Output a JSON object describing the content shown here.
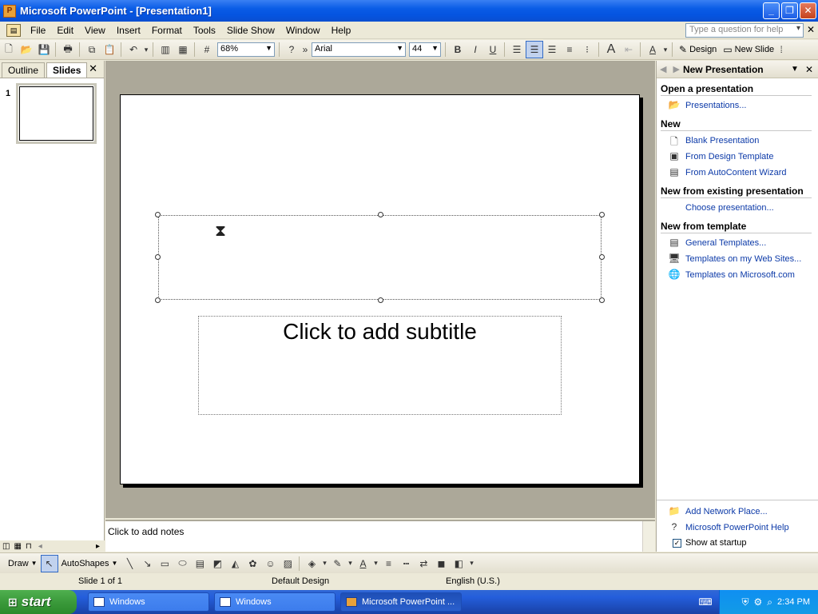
{
  "window": {
    "title": "Microsoft PowerPoint - [Presentation1]"
  },
  "menu": {
    "items": [
      "File",
      "Edit",
      "View",
      "Insert",
      "Format",
      "Tools",
      "Slide Show",
      "Window",
      "Help"
    ],
    "help_placeholder": "Type a question for help"
  },
  "toolbar": {
    "zoom": "68%",
    "font": "Arial",
    "size": "44",
    "design_label": "Design",
    "new_slide_label": "New Slide"
  },
  "leftpane": {
    "tabs": [
      "Outline",
      "Slides"
    ],
    "slide_number": "1"
  },
  "slide": {
    "subtitle_placeholder": "Click to add subtitle"
  },
  "notes": {
    "placeholder": "Click to add notes"
  },
  "taskpane": {
    "title": "New Presentation",
    "sections": [
      {
        "heading": "Open a presentation",
        "links": [
          "Presentations..."
        ]
      },
      {
        "heading": "New",
        "links": [
          "Blank Presentation",
          "From Design Template",
          "From AutoContent Wizard"
        ]
      },
      {
        "heading": "New from existing presentation",
        "links": [
          "Choose presentation..."
        ]
      },
      {
        "heading": "New from template",
        "links": [
          "General Templates...",
          "Templates on my Web Sites...",
          "Templates on Microsoft.com"
        ]
      }
    ],
    "bottom_links": [
      "Add Network Place...",
      "Microsoft PowerPoint Help"
    ],
    "show_at_startup": "Show at startup"
  },
  "drawbar": {
    "draw_label": "Draw",
    "autoshapes_label": "AutoShapes"
  },
  "status": {
    "slide": "Slide 1 of 1",
    "design": "Default Design",
    "language": "English (U.S.)"
  },
  "taskbar": {
    "start_label": "start",
    "items": [
      "Windows",
      "Windows",
      "Microsoft PowerPoint ..."
    ],
    "clock": "2:34 PM"
  }
}
